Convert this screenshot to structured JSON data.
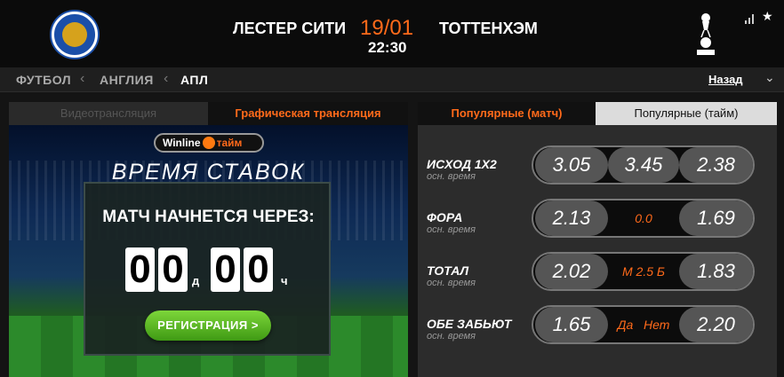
{
  "header": {
    "home_team": "ЛЕСТЕР СИТИ",
    "away_team": "ТОТТЕНХЭМ",
    "date": "19/01",
    "time": "22:30",
    "crest_home_text": "LEICESTER CITY FOOTBALL CLUB"
  },
  "breadcrumb": {
    "items": [
      "ФУТБОЛ",
      "АНГЛИЯ",
      "АПЛ"
    ],
    "back_label": "Назад"
  },
  "left_panel": {
    "tabs": [
      "Видеотрансляция",
      "Графическая трансляция"
    ],
    "brand_left": "Winline",
    "brand_right": "тайм",
    "title": "ВРЕМЯ СТАВОК",
    "countdown_label": "МАТЧ НАЧНЕТСЯ ЧЕРЕЗ:",
    "days": [
      "0",
      "0"
    ],
    "days_unit": "д",
    "hours": [
      "0",
      "0"
    ],
    "hours_unit": "ч",
    "register_label": "РЕГИСТРАЦИЯ >"
  },
  "right_panel": {
    "tabs": [
      "Популярные (матч)",
      "Популярные (тайм)"
    ],
    "markets": [
      {
        "name": "ИСХОД 1Х2",
        "sub": "осн. время",
        "left": "3.05",
        "mid": "3.45",
        "right": "2.38"
      },
      {
        "name": "ФОРА",
        "sub": "осн. время",
        "left": "2.13",
        "mid": "0.0",
        "right": "1.69"
      },
      {
        "name": "ТОТАЛ",
        "sub": "осн. время",
        "left": "2.02",
        "mid": "М 2.5 Б",
        "right": "1.83"
      },
      {
        "name": "ОБЕ ЗАБЬЮТ",
        "sub": "осн. время",
        "left": "1.65",
        "mid": "Да   Нет",
        "right": "2.20"
      }
    ]
  },
  "colors": {
    "accent": "#ff6a1a",
    "button_green": "#4fb01c"
  }
}
